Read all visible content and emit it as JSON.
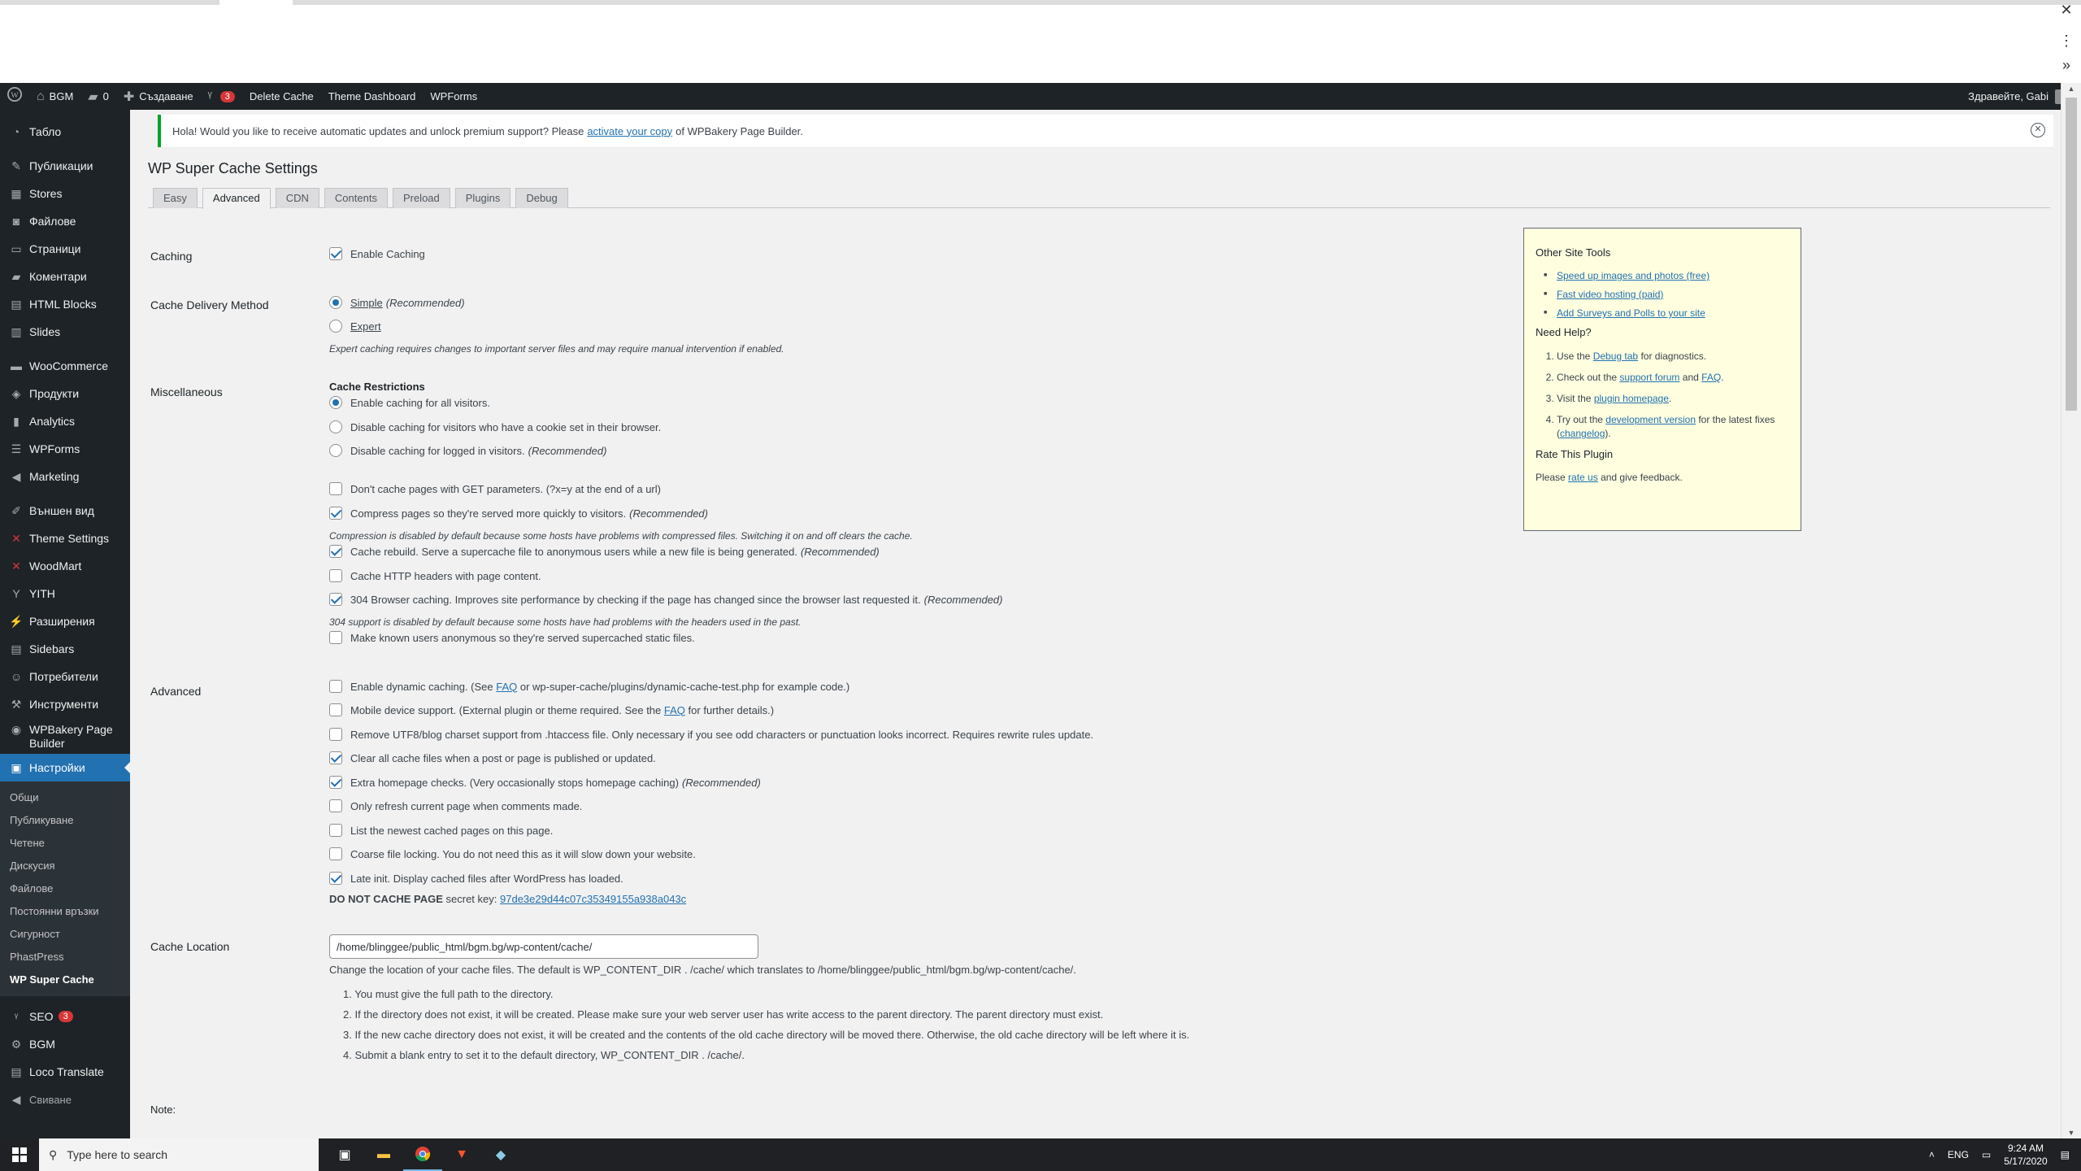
{
  "browser": {
    "close": "✕",
    "menu": "⋮",
    "more": "»"
  },
  "adminbar": {
    "site": "BGM",
    "comments_count": "0",
    "new": "Създаване",
    "yoast_count": "3",
    "delete_cache": "Delete Cache",
    "theme_dashboard": "Theme Dashboard",
    "wpforms": "WPForms",
    "greeting": "Здравейте, Gabi"
  },
  "sidebar": {
    "items": [
      {
        "label": "Табло",
        "icon": "dashboard-icon"
      },
      {
        "label": "Публикации",
        "icon": "pin-icon"
      },
      {
        "label": "Stores",
        "icon": "store-icon"
      },
      {
        "label": "Файлове",
        "icon": "media-icon"
      },
      {
        "label": "Страници",
        "icon": "page-icon"
      },
      {
        "label": "Коментари",
        "icon": "comment-icon"
      },
      {
        "label": "HTML Blocks",
        "icon": "blocks-icon"
      },
      {
        "label": "Slides",
        "icon": "slides-icon"
      },
      {
        "label": "WooCommerce",
        "icon": "woo-icon"
      },
      {
        "label": "Продукти",
        "icon": "products-icon"
      },
      {
        "label": "Analytics",
        "icon": "analytics-icon"
      },
      {
        "label": "WPForms",
        "icon": "forms-icon"
      },
      {
        "label": "Marketing",
        "icon": "megaphone-icon"
      },
      {
        "label": "Външен вид",
        "icon": "brush-icon"
      },
      {
        "label": "Theme Settings",
        "icon": "theme-settings-icon"
      },
      {
        "label": "WoodMart",
        "icon": "woodmart-icon"
      },
      {
        "label": "YITH",
        "icon": "yith-icon"
      },
      {
        "label": "Разширения",
        "icon": "plugin-icon"
      },
      {
        "label": "Sidebars",
        "icon": "sidebars-icon"
      },
      {
        "label": "Потребители",
        "icon": "users-icon"
      },
      {
        "label": "Инструменти",
        "icon": "tools-icon"
      },
      {
        "label": "WPBakery Page Builder",
        "icon": "wpbakery-icon"
      },
      {
        "label": "Настройки",
        "icon": "settings-icon"
      }
    ],
    "submenu": [
      "Общи",
      "Публикуване",
      "Четене",
      "Дискусия",
      "Файлове",
      "Постоянни връзки",
      "Сигурност",
      "PhastPress",
      "WP Super Cache"
    ],
    "bottom": [
      {
        "label": "SEO",
        "icon": "seo-icon",
        "badge": "3"
      },
      {
        "label": "BGM",
        "icon": "gear-icon"
      },
      {
        "label": "Loco Translate",
        "icon": "translate-icon"
      },
      {
        "label": "Свиване",
        "icon": "collapse-icon"
      }
    ]
  },
  "notice": {
    "text_before": "Hola! Would you like to receive automatic updates and unlock premium support? Please",
    "link": "activate your copy",
    "text_after": "of WPBakery Page Builder."
  },
  "page_title": "WP Super Cache Settings",
  "tabs": [
    "Easy",
    "Advanced",
    "CDN",
    "Contents",
    "Preload",
    "Plugins",
    "Debug"
  ],
  "caching": {
    "label": "Caching",
    "enable": "Enable Caching"
  },
  "delivery": {
    "label": "Cache Delivery Method",
    "simple": "Simple",
    "simple_rec": "(Recommended)",
    "expert": "Expert",
    "desc": "Expert caching requires changes to important server files and may require manual intervention if enabled."
  },
  "misc": {
    "label": "Miscellaneous",
    "restrictions": "Cache Restrictions",
    "r1": "Enable caching for all visitors.",
    "r2": "Disable caching for visitors who have a cookie set in their browser.",
    "r3": "Disable caching for logged in visitors.",
    "r3_rec": "(Recommended)",
    "get": "Don't cache pages with GET parameters. (?x=y at the end of a url)",
    "compress": "Compress pages so they're served more quickly to visitors.",
    "compress_rec": "(Recommended)",
    "compress_desc": "Compression is disabled by default because some hosts have problems with compressed files. Switching it on and off clears the cache.",
    "rebuild": "Cache rebuild. Serve a supercache file to anonymous users while a new file is being generated.",
    "rebuild_rec": "(Recommended)",
    "headers": "Cache HTTP headers with page content.",
    "b304": "304 Browser caching. Improves site performance by checking if the page has changed since the browser last requested it.",
    "b304_rec": "(Recommended)",
    "b304_desc": "304 support is disabled by default because some hosts have had problems with the headers used in the past.",
    "anon": "Make known users anonymous so they're served supercached static files."
  },
  "advanced": {
    "label": "Advanced",
    "dynamic_a": "Enable dynamic caching. (See",
    "dynamic_link": "FAQ",
    "dynamic_b": "or wp-super-cache/plugins/dynamic-cache-test.php for example code.)",
    "mobile_a": "Mobile device support. (External plugin or theme required. See the",
    "mobile_link": "FAQ",
    "mobile_b": "for further details.)",
    "utf8": "Remove UTF8/blog charset support from .htaccess file. Only necessary if you see odd characters or punctuation looks incorrect. Requires rewrite rules update.",
    "clear": "Clear all cache files when a post or page is published or updated.",
    "extra": "Extra homepage checks. (Very occasionally stops homepage caching)",
    "extra_rec": "(Recommended)",
    "refresh": "Only refresh current page when comments made.",
    "newest": "List the newest cached pages on this page.",
    "coarse": "Coarse file locking. You do not need this as it will slow down your website.",
    "late": "Late init. Display cached files after WordPress has loaded.",
    "secret_label": "DO NOT CACHE PAGE",
    "secret_mid": "secret key:",
    "secret_key": "97de3e29d44c07c35349155a938a043c"
  },
  "location": {
    "label": "Cache Location",
    "value": "/home/blinggee/public_html/bgm.bg/wp-content/cache/",
    "desc": "Change the location of your cache files. The default is WP_CONTENT_DIR . /cache/ which translates to /home/blinggee/public_html/bgm.bg/wp-content/cache/.",
    "list": [
      "1. You must give the full path to the directory.",
      "2. If the directory does not exist, it will be created. Please make sure your web server user has write access to the parent directory. The parent directory must exist.",
      "3. If the new cache directory does not exist, it will be created and the contents of the old cache directory will be moved there. Otherwise, the old cache directory will be left where it is.",
      "4. Submit a blank entry to set it to the default directory, WP_CONTENT_DIR . /cache/."
    ]
  },
  "note_label": "Note:",
  "sidebox": {
    "tools_title": "Other Site Tools",
    "tools": [
      "Speed up images and photos (free)",
      "Fast video hosting (paid)",
      "Add Surveys and Polls to your site"
    ],
    "help_title": "Need Help?",
    "h1_a": "Use the",
    "h1_link": "Debug tab",
    "h1_b": "for diagnostics.",
    "h2_a": "Check out the",
    "h2_link1": "support forum",
    "h2_mid": "and",
    "h2_link2": "FAQ",
    "h2_b": ".",
    "h3_a": "Visit the",
    "h3_link": "plugin homepage",
    "h3_b": ".",
    "h4_a": "Try out the",
    "h4_link": "development version",
    "h4_b": "for the latest fixes (",
    "h4_link2": "changelog",
    "h4_c": ").",
    "rate_title": "Rate This Plugin",
    "rate_a": "Please",
    "rate_link": "rate us",
    "rate_b": "and give feedback."
  },
  "taskbar": {
    "search_placeholder": "Type here to search",
    "lang": "ENG",
    "time": "9:24 AM",
    "date": "5/17/2020"
  }
}
